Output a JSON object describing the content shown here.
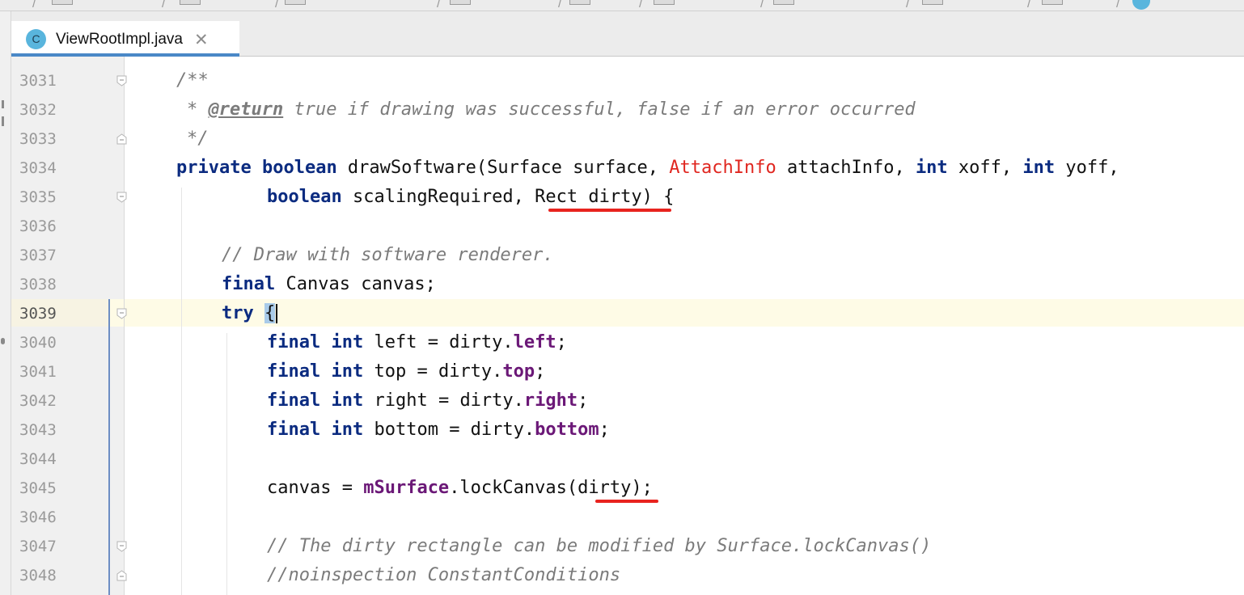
{
  "tab": {
    "file_name": "ViewRootImpl.java",
    "icon_letter": "C",
    "close_glyph": "✕"
  },
  "editor": {
    "partial_top_line": "3030",
    "caret_line": "3039",
    "lines": [
      {
        "number": "3031"
      },
      {
        "number": "3032"
      },
      {
        "number": "3033"
      },
      {
        "number": "3034"
      },
      {
        "number": "3035"
      },
      {
        "number": "3036"
      },
      {
        "number": "3037"
      },
      {
        "number": "3038"
      },
      {
        "number": "3039"
      },
      {
        "number": "3040"
      },
      {
        "number": "3041"
      },
      {
        "number": "3042"
      },
      {
        "number": "3043"
      },
      {
        "number": "3044"
      },
      {
        "number": "3045"
      },
      {
        "number": "3046"
      },
      {
        "number": "3047"
      },
      {
        "number": "3048"
      }
    ],
    "code": {
      "l3031": "/**",
      "l3032_star": "* ",
      "l3032_tag": "@return",
      "l3032_text": " true if drawing was successful, false if an error occurred",
      "l3033": "*/",
      "l3034_private": "private",
      "l3034_boolean": "boolean",
      "l3034_a": " drawSoftware(Surface surface, ",
      "l3034_attach": "AttachInfo",
      "l3034_b": " attachInfo, ",
      "l3034_int1": "int",
      "l3034_c": " xoff, ",
      "l3034_int2": "int",
      "l3034_d": " yoff,",
      "l3035_boolean": "boolean",
      "l3035_a": " scalingRequired, Rect dirty) {",
      "l3037": "// Draw with software renderer.",
      "l3038_final": "final",
      "l3038_a": " Canvas canvas;",
      "l3039_try": "try",
      "l3039_brace": "{",
      "final": "final",
      "int": "int",
      "l3040_a": " left = dirty.",
      "l3040_f": "left",
      "l3041_a": " top = dirty.",
      "l3041_f": "top",
      "l3042_a": " right = dirty.",
      "l3042_f": "right",
      "l3043_a": " bottom = dirty.",
      "l3043_f": "bottom",
      "semi": ";",
      "l3045_a": "canvas = ",
      "l3045_f": "mSurface",
      "l3045_b": ".lockCanvas(dirty);",
      "l3047": "// The dirty rectangle can be modified by Surface.lockCanvas()",
      "l3048": "//noinspection ConstantConditions"
    }
  },
  "colors": {
    "keyword": "#0b2b80",
    "comment": "#7b7b7b",
    "error_type": "#e0261f",
    "field": "#6b1877",
    "annotation_underline": "#e8231e",
    "tab_active_underline": "#4a88c7",
    "caret_row": "#fefbe6"
  }
}
